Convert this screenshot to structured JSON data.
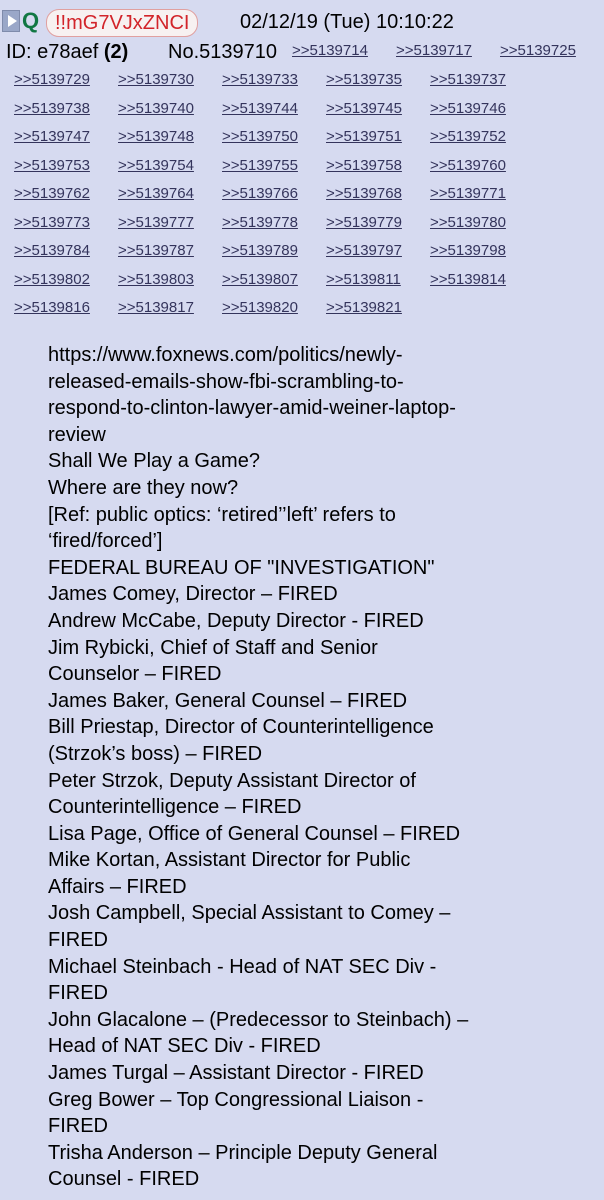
{
  "header": {
    "icon": "play-icon",
    "q_label": "Q",
    "tripcode": "!!mG7VJxZNCI",
    "datetime": "02/12/19 (Tue) 10:10:22",
    "id_label": "ID: e78aef",
    "id_count": "(2)",
    "post_number": "No.5139710"
  },
  "replies": [
    ">>5139714",
    ">>5139717",
    ">>5139725",
    ">>5139729",
    ">>5139730",
    ">>5139733",
    ">>5139735",
    ">>5139737",
    ">>5139738",
    ">>5139740",
    ">>5139744",
    ">>5139745",
    ">>5139746",
    ">>5139747",
    ">>5139748",
    ">>5139750",
    ">>5139751",
    ">>5139752",
    ">>5139753",
    ">>5139754",
    ">>5139755",
    ">>5139758",
    ">>5139760",
    ">>5139762",
    ">>5139764",
    ">>5139766",
    ">>5139768",
    ">>5139771",
    ">>5139773",
    ">>5139777",
    ">>5139778",
    ">>5139779",
    ">>5139780",
    ">>5139784",
    ">>5139787",
    ">>5139789",
    ">>5139797",
    ">>5139798",
    ">>5139802",
    ">>5139803",
    ">>5139807",
    ">>5139811",
    ">>5139814",
    ">>5139816",
    ">>5139817",
    ">>5139820",
    ">>5139821"
  ],
  "body_lines": [
    "https://www.foxnews.com/politics/newly-",
    "released-emails-show-fbi-scrambling-to-",
    "respond-to-clinton-lawyer-amid-weiner-laptop-",
    "review",
    "Shall We Play a Game?",
    "Where are they now?",
    "[Ref: public optics: ‘retired’’left’ refers to",
    "‘fired/forced’]",
    "FEDERAL BUREAU OF \"INVESTIGATION\"",
    "James Comey, Director – FIRED",
    "Andrew McCabe, Deputy Director - FIRED",
    "Jim Rybicki, Chief of Staff and Senior",
    "Counselor – FIRED",
    "James Baker, General Counsel – FIRED",
    "Bill Priestap, Director of Counterintelligence",
    "(Strzok’s boss) – FIRED",
    "Peter Strzok, Deputy Assistant Director of",
    "Counterintelligence – FIRED",
    "Lisa Page, Office of General Counsel – FIRED",
    "Mike Kortan, Assistant Director for Public",
    "Affairs – FIRED",
    "Josh Campbell, Special Assistant to Comey –",
    "FIRED",
    "Michael Steinbach - Head of NAT SEC Div -",
    "FIRED",
    "John Glacalone – (Predecessor to Steinbach) –",
    "Head of NAT SEC Div - FIRED",
    "James Turgal – Assistant Director - FIRED",
    "Greg Bower – Top Congressional Liaison -",
    "FIRED",
    "Trisha Anderson – Principle Deputy General",
    "Counsel - FIRED"
  ]
}
